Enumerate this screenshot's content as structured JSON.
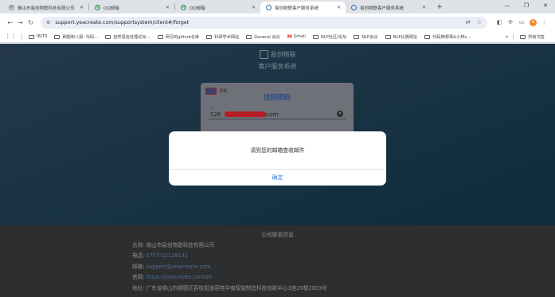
{
  "browser": {
    "tabs": [
      {
        "label": "佛山市易创物联科技有限公司",
        "icon": "globe-icon"
      },
      {
        "label": "QQ邮箱",
        "icon": "qq-mail-icon"
      },
      {
        "label": "QQ邮箱",
        "icon": "qq-mail-icon"
      },
      {
        "label": "易创物联客户服务系统",
        "icon": "site-icon",
        "active": true
      },
      {
        "label": "易创物联客户服务系统",
        "icon": "site-icon"
      }
    ],
    "new_tab": "+",
    "window_controls": {
      "minimize": "—",
      "restore": "❐",
      "close": "✕"
    },
    "url": "support.yeacreate.com/supportsystem/client#/forget",
    "bookmarks": [
      "IELTS",
      "刷题和八股: 代码...",
      "自然语言处理论坛...",
      "师兄的github仓库",
      "科研学术网站",
      "General 会议",
      "Gmail",
      "NLP社区/论坛",
      "NLP会议",
      "NLP比赛网址",
      "代码随想录&小林c..."
    ],
    "all_bookmarks": "所有书签"
  },
  "page": {
    "brand_name": "易创物联",
    "brand_sub": "客户服务系统",
    "card": {
      "lang": "EN",
      "title": "找回密码",
      "email_prefix": "526",
      "email_suffix": ".com"
    },
    "dialog": {
      "message": "请到您的邮箱查收邮件",
      "confirm": "确定"
    },
    "footer": {
      "title": "公司联系信息",
      "rows": [
        {
          "label": "名称:",
          "value": "佛山市易创物联科技有限公司",
          "link": false
        },
        {
          "label": "电话:",
          "value": "0757-22128141",
          "link": true
        },
        {
          "label": "邮箱:",
          "value": "support@yeacreate.com",
          "link": true
        },
        {
          "label": "官网:",
          "value": "https://yeacreate.com/zh",
          "link": true
        },
        {
          "label": "地址:",
          "value": "广东省佛山市顺德区容桂街道容桂华南智能制造科技创新中心3座20楼2003号",
          "link": false
        }
      ]
    }
  }
}
